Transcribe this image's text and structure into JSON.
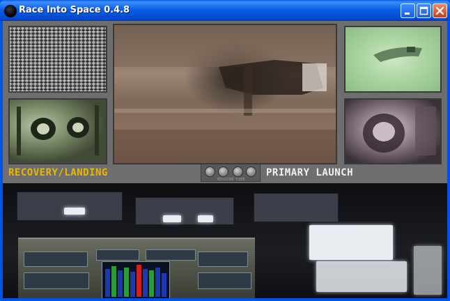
{
  "window": {
    "title": "Race Into Space 0.4.8"
  },
  "titlebar_buttons": {
    "minimize": "minimize-icon",
    "maximize": "maximize-icon",
    "close": "close-icon"
  },
  "mission": {
    "left_label": "RECOVERY/LANDING",
    "right_label": "PRIMARY LAUNCH",
    "control_caption": "MISSION TIME"
  },
  "colors": {
    "title_bar": "#0054e3",
    "left_label": "#e8b800",
    "right_label": "#f0f0f0",
    "panel_bg": "#6e6e6e"
  }
}
